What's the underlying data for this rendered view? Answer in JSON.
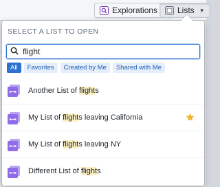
{
  "toolbar": {
    "explorations_label": "Explorations",
    "explorations_icon": "exploration-icon",
    "lists_label": "Lists",
    "lists_icon": "lists-icon"
  },
  "popover": {
    "heading": "SELECT A LIST TO OPEN",
    "search": {
      "value": "flight",
      "icon": "search-icon"
    },
    "filters": [
      {
        "label": "All",
        "active": true
      },
      {
        "label": "Favorites",
        "active": false
      },
      {
        "label": "Created by Me",
        "active": false
      },
      {
        "label": "Shared with Me",
        "active": false
      }
    ],
    "items": [
      {
        "pre": "Another List of ",
        "match": "flight",
        "post": "s",
        "favorite": false
      },
      {
        "pre": "My List of ",
        "match": "flight",
        "post": "s leaving California",
        "favorite": true
      },
      {
        "pre": "My List of ",
        "match": "flight",
        "post": "s leaving NY",
        "favorite": false
      },
      {
        "pre": "Different List of ",
        "match": "flight",
        "post": "s",
        "favorite": false
      }
    ]
  },
  "colors": {
    "accent": "#2d72d2",
    "list_icon": "#8f6dea",
    "highlight": "#fcefc2",
    "star": "#f0b726"
  }
}
